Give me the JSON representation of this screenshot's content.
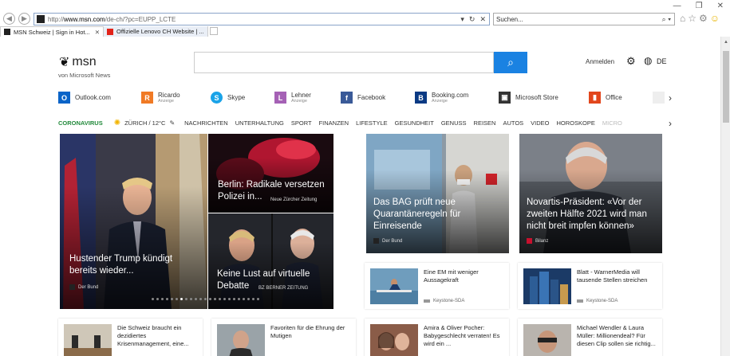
{
  "browser": {
    "address": "http://www.msn.com/de-ch/?pc=EUPP_LCTE",
    "address_host": "www.msn.com",
    "address_pre": "http://",
    "address_post": "/de-ch/?pc=EUPP_LCTE",
    "search_placeholder": "Suchen...",
    "tabs": [
      {
        "label": "MSN Schweiz | Sign in Hot..."
      },
      {
        "label": "Offizielle Lenovo CH Website | ..."
      }
    ]
  },
  "header": {
    "logo_text": "msn",
    "logo_sub": "von Microsoft News",
    "signin": "Anmelden",
    "lang": "DE"
  },
  "quicklinks": [
    {
      "label": "Outlook.com",
      "sub": "",
      "icon": "outlook-icon",
      "color": "#0a64c8",
      "glyph": "O"
    },
    {
      "label": "Ricardo",
      "sub": "Anzeige",
      "icon": "ricardo-icon",
      "color": "#f07a25",
      "glyph": "R"
    },
    {
      "label": "Skype",
      "sub": "",
      "icon": "skype-icon",
      "color": "#1aa3e8",
      "glyph": "S"
    },
    {
      "label": "Lehner",
      "sub": "Anzeige",
      "icon": "lehner-icon",
      "color": "#a561b5",
      "glyph": "L"
    },
    {
      "label": "Facebook",
      "sub": "",
      "icon": "facebook-icon",
      "color": "#3a5a98",
      "glyph": "f"
    },
    {
      "label": "Booking.com",
      "sub": "Anzeige",
      "icon": "booking-icon",
      "color": "#0b3a84",
      "glyph": "B"
    },
    {
      "label": "Microsoft Store",
      "sub": "",
      "icon": "store-icon",
      "color": "#333333",
      "glyph": "▣"
    },
    {
      "label": "Office",
      "sub": "",
      "icon": "office-icon",
      "color": "#e2461c",
      "glyph": "▮"
    }
  ],
  "categories": {
    "corona": "CORONAVIRUS",
    "weather": "ZÜRICH / 12°C",
    "items": [
      "NACHRICHTEN",
      "UNTERHALTUNG",
      "SPORT",
      "FINANZEN",
      "LIFESTYLE",
      "GESUNDHEIT",
      "GENUSS",
      "REISEN",
      "AUTOS",
      "VIDEO",
      "HOROSKOPE"
    ],
    "faded": "MICRO"
  },
  "hero": {
    "trump": {
      "title": "Hustender Trump kündigt bereits wieder...",
      "source": "Der Bund"
    },
    "berlin": {
      "title": "Berlin: Radikale versetzen Polizei in...",
      "source": "Neue Zürcher Zeitung"
    },
    "debatte": {
      "title": "Keine Lust auf virtuelle Debatte",
      "source": "BZ BERNER ZEITUNG"
    },
    "bag": {
      "title": "Das BAG prüft neue Quarantäneregeln für Einreisende",
      "source": "Der Bund"
    },
    "novartis": {
      "title": "Novartis-Präsident: «Vor der zweiten Hälfte 2021 wird man nicht breit impfen können»",
      "source": "Bilanz"
    }
  },
  "small_cards": [
    {
      "title": "Eine EM mit weniger Aussagekraft",
      "source": "Keystone-SDA"
    },
    {
      "title": "Blatt - WarnerMedia will tausende Stellen streichen",
      "source": "Keystone-SDA"
    },
    {
      "title": "Die Schweiz braucht ein dezidiertes Krisenmanagement, eine...",
      "source": ""
    },
    {
      "title": "Favoriten für die Ehrung der Mutigen",
      "source": ""
    },
    {
      "title": "Amira & Oliver Pocher: Babygeschlecht verraten! Es wird ein ...",
      "source": ""
    },
    {
      "title": "Michael Wendler & Laura Müller: Millionendeal? Für diesen Clip sollen sie richtig...",
      "source": ""
    }
  ]
}
